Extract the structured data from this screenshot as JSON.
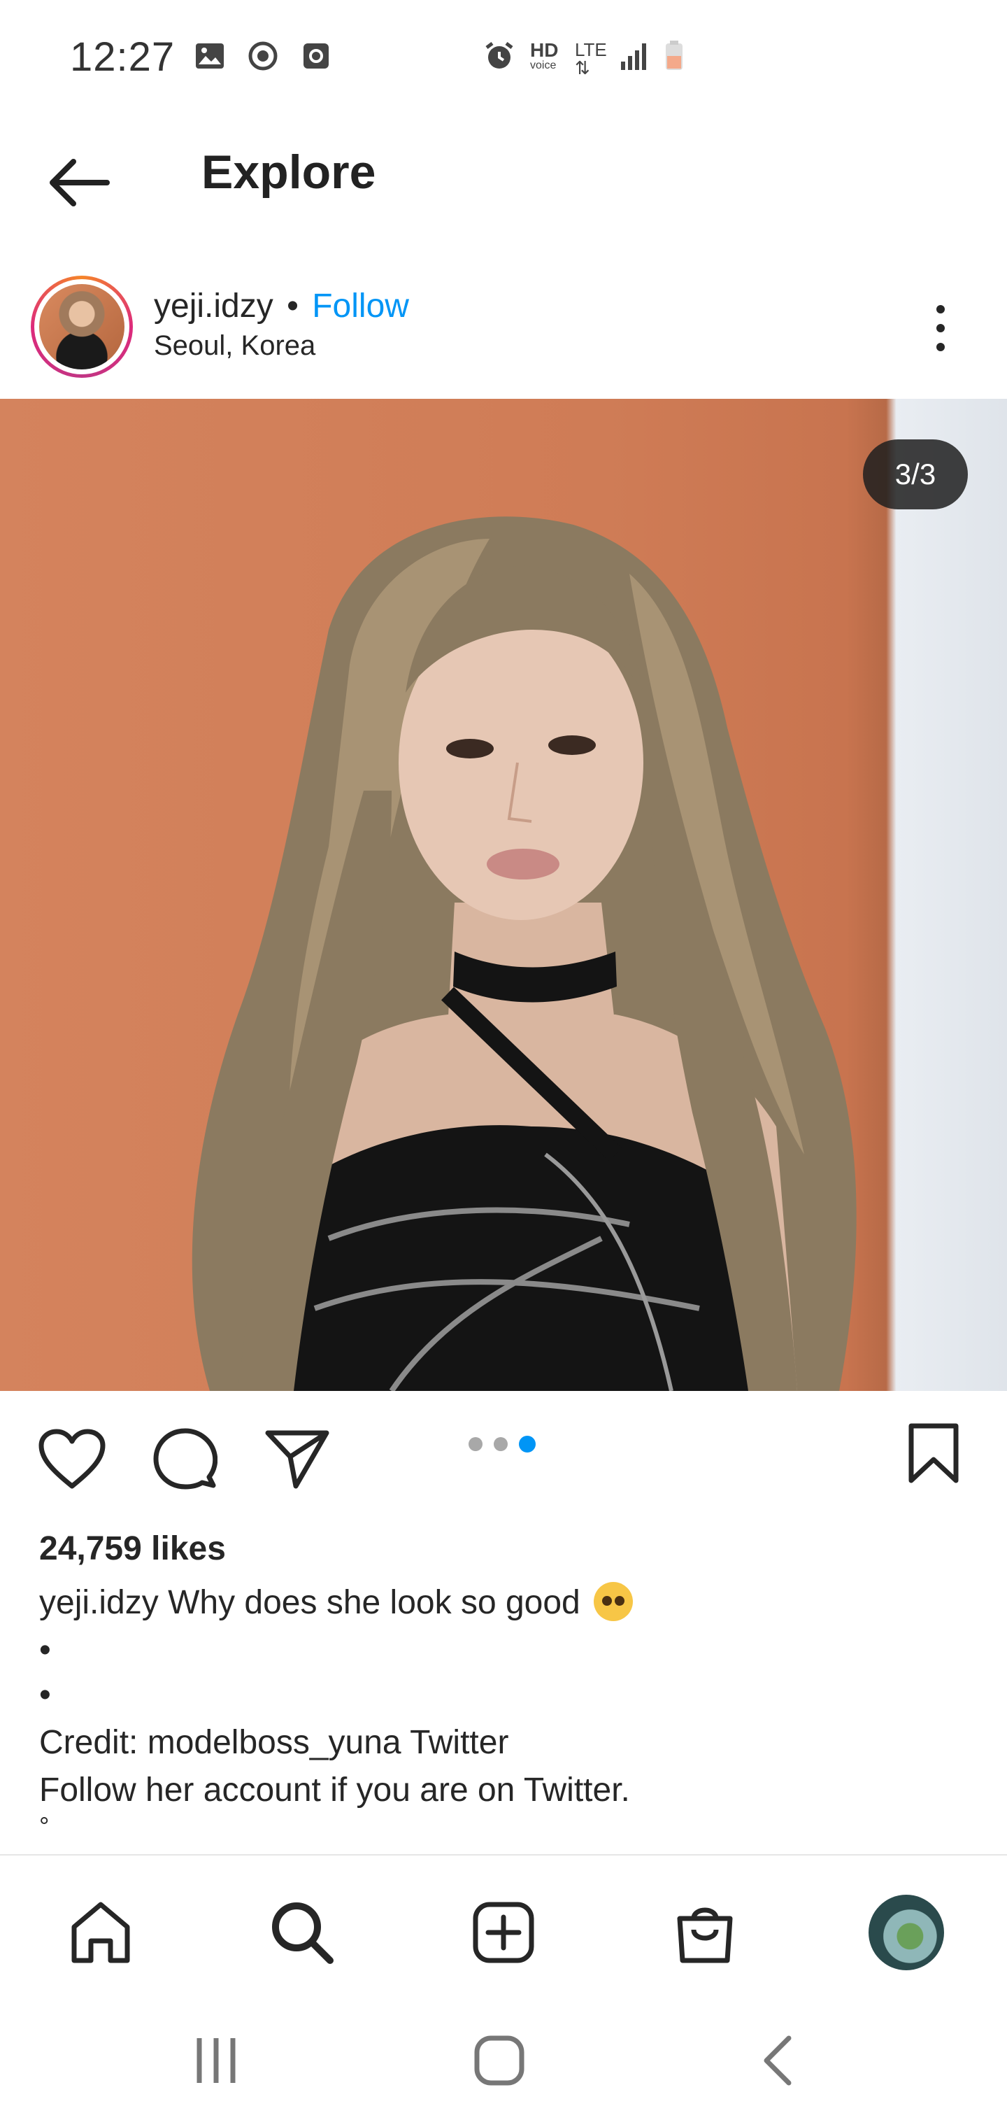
{
  "status_bar": {
    "time": "12:27",
    "network_hd": "HD",
    "network_voice": "voice",
    "network_lte": "LTE",
    "icons": [
      "gallery-icon",
      "sync-icon",
      "screenshot-icon",
      "alarm-icon",
      "signal-icon",
      "battery-icon"
    ],
    "battery_color": "#f4a98a"
  },
  "header": {
    "title": "Explore"
  },
  "post": {
    "username": "yeji.idzy",
    "separator": "•",
    "follow_label": "Follow",
    "location": "Seoul, Korea",
    "photo_counter": "3/3",
    "carousel": {
      "count": 3,
      "active_index": 2
    },
    "likes": "24,759 likes",
    "caption": {
      "user": "yeji.idzy",
      "text": "Why does she look so good",
      "emoji": "pleading-face-emoji",
      "bullet1": "•",
      "bullet2": "•",
      "credit": "Credit: modelboss_yuna  Twitter",
      "follow_note": "Follow her account if you are on Twitter.",
      "trailing": "°"
    }
  },
  "colors": {
    "accent_blue": "#0095f6",
    "text": "#262626",
    "photo_wall": "#d4835d"
  },
  "bottom_nav": [
    "home-icon",
    "search-icon",
    "new-post-icon",
    "shop-icon",
    "profile-avatar"
  ],
  "system_nav": [
    "recents-button",
    "home-button",
    "back-button"
  ]
}
